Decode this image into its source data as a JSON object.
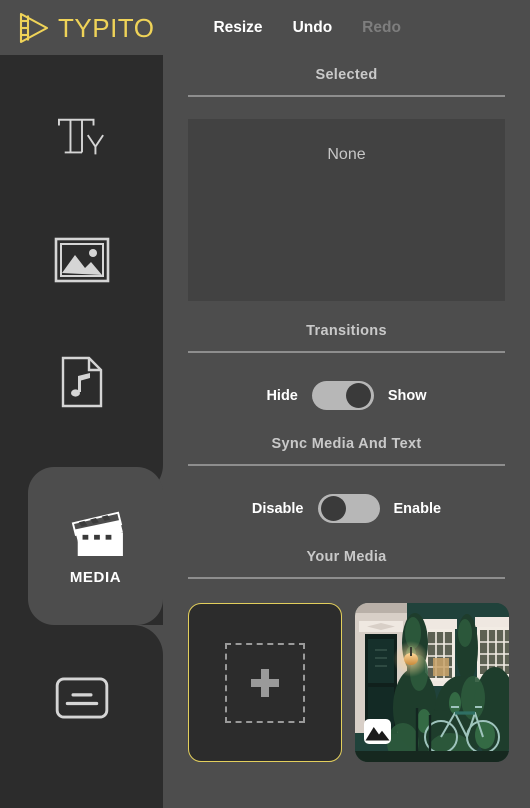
{
  "app": {
    "brand": "TYPITO",
    "logo_color": "#efd358",
    "background": "#4d4d4d",
    "sidebar_background": "#2c2c2c"
  },
  "header": {
    "buttons": [
      {
        "label": "Resize",
        "name": "resize-button",
        "disabled": false
      },
      {
        "label": "Undo",
        "name": "undo-button",
        "disabled": false
      },
      {
        "label": "Redo",
        "name": "redo-button",
        "disabled": true
      }
    ]
  },
  "sidebar": {
    "items": [
      {
        "label": "",
        "icon": "text-ty-icon",
        "active": false
      },
      {
        "label": "",
        "icon": "image-icon",
        "active": false
      },
      {
        "label": "",
        "icon": "audio-note-icon",
        "active": false
      },
      {
        "label": "MEDIA",
        "icon": "clapperboard-icon",
        "active": true
      },
      {
        "label": "",
        "icon": "subtitles-icon",
        "active": false
      }
    ]
  },
  "panel": {
    "selected": {
      "title": "Selected",
      "value": "None"
    },
    "transitions": {
      "title": "Transitions",
      "off_label": "Hide",
      "on_label": "Show",
      "state": "on"
    },
    "sync": {
      "title": "Sync Media And Text",
      "off_label": "Disable",
      "on_label": "Enable",
      "state": "off"
    },
    "your_media": {
      "title": "Your Media",
      "add_card": {
        "name": "add-media-card",
        "icon": "plus-icon",
        "border_color": "#e3cf5c"
      },
      "items": [
        {
          "name": "media-thumbnail",
          "badge_icon": "image-badge-icon",
          "description": "House facade with windows, ivy and bicycle"
        }
      ]
    }
  }
}
